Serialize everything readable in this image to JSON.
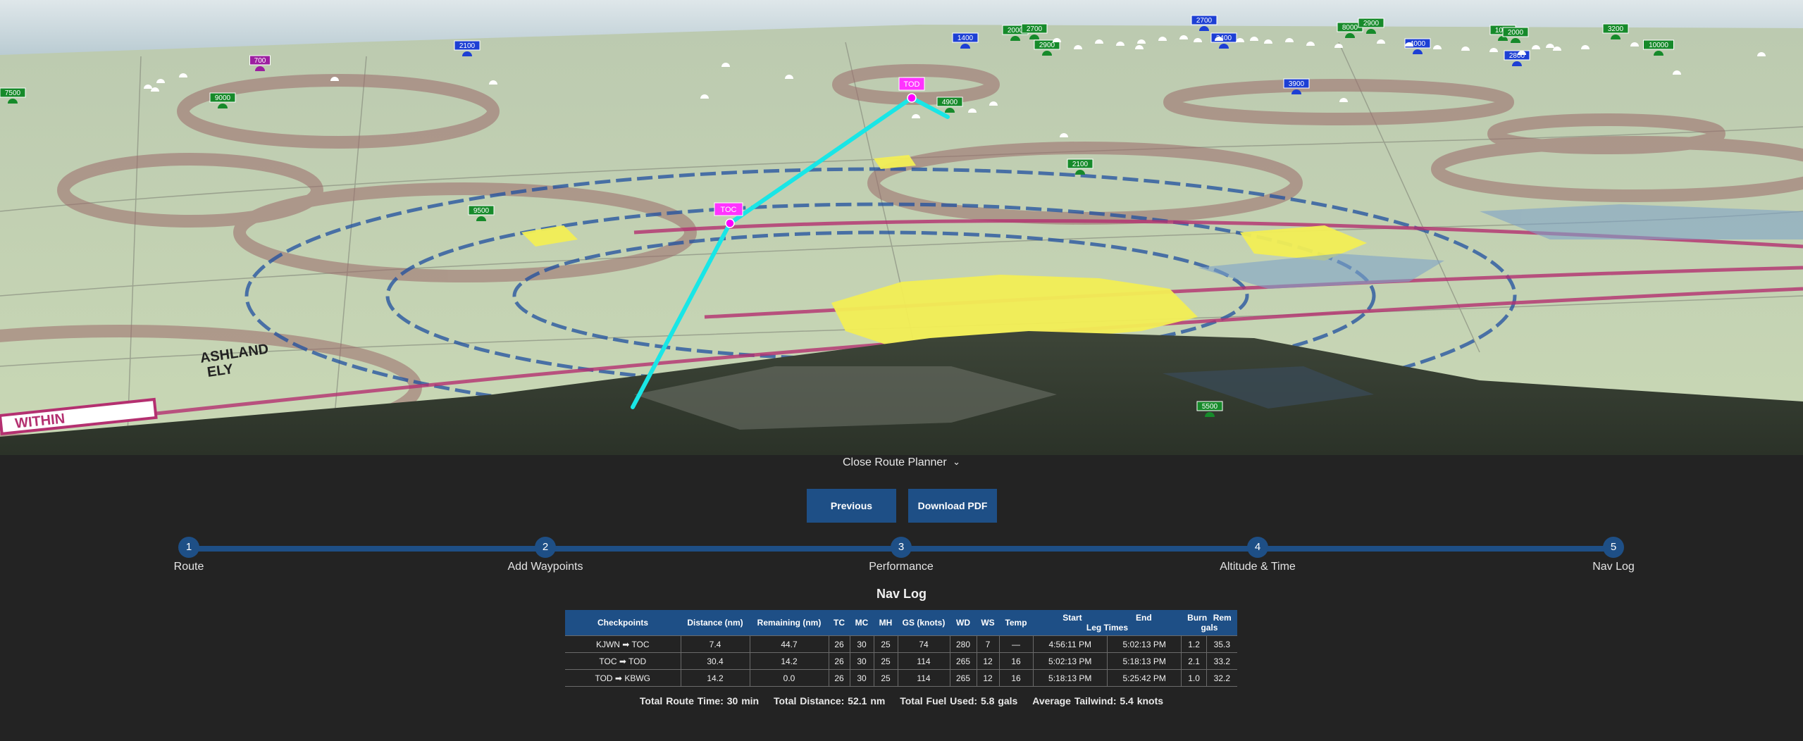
{
  "map": {
    "waypoint_labels": {
      "toc": "TOC",
      "tod": "TOD"
    },
    "altitude_markers": [
      "7500",
      "700",
      "2100",
      "9000",
      "1400",
      "2000",
      "2700",
      "2900",
      "2700",
      "2400",
      "8000",
      "2900",
      "4000",
      "2800",
      "3200",
      "10000",
      "3900",
      "4900",
      "2100",
      "9500",
      "5500",
      "1000",
      "2000"
    ],
    "chart_text": [
      "ASHLAND",
      "ELY",
      "WITHIN"
    ],
    "colors": {
      "route": "#19e6e6",
      "waypoint": "#ff00ff",
      "terrain": "#c8d6b0",
      "water": "#f4f04a"
    }
  },
  "panel": {
    "close_label": "Close Route Planner",
    "close_icon": "chevron-down-icon",
    "previous_label": "Previous",
    "download_label": "Download PDF",
    "steps": [
      {
        "num": "1",
        "label": "Route"
      },
      {
        "num": "2",
        "label": "Add Waypoints"
      },
      {
        "num": "3",
        "label": "Performance"
      },
      {
        "num": "4",
        "label": "Altitude & Time"
      },
      {
        "num": "5",
        "label": "Nav Log"
      }
    ],
    "current_step": 5
  },
  "navlog": {
    "title": "Nav Log",
    "headers": {
      "checkpoints": "Checkpoints",
      "distance": "Distance (nm)",
      "remaining": "Remaining (nm)",
      "tc": "TC",
      "mc": "MC",
      "mh": "MH",
      "gs": "GS (knots)",
      "wd": "WD",
      "ws": "WS",
      "temp": "Temp",
      "start": "Start",
      "end": "End",
      "leg_times": "Leg Times",
      "burn": "Burn",
      "rem": "Rem",
      "gals": "gals"
    },
    "rows": [
      {
        "checkpoints": "KJWN ➡ TOC",
        "distance": "7.4",
        "remaining": "44.7",
        "tc": "26",
        "mc": "30",
        "mh": "25",
        "gs": "74",
        "wd": "280",
        "ws": "7",
        "temp": "—",
        "start": "4:56:11 PM",
        "end": "5:02:13 PM",
        "burn": "1.2",
        "rem": "35.3"
      },
      {
        "checkpoints": "TOC ➡ TOD",
        "distance": "30.4",
        "remaining": "14.2",
        "tc": "26",
        "mc": "30",
        "mh": "25",
        "gs": "114",
        "wd": "265",
        "ws": "12",
        "temp": "16",
        "start": "5:02:13 PM",
        "end": "5:18:13 PM",
        "burn": "2.1",
        "rem": "33.2"
      },
      {
        "checkpoints": "TOD ➡ KBWG",
        "distance": "14.2",
        "remaining": "0.0",
        "tc": "26",
        "mc": "30",
        "mh": "25",
        "gs": "114",
        "wd": "265",
        "ws": "12",
        "temp": "16",
        "start": "5:18:13 PM",
        "end": "5:25:42 PM",
        "burn": "1.0",
        "rem": "32.2"
      }
    ],
    "totals": {
      "route_time": "Total Route Time: 30 min",
      "distance": "Total Distance: 52.1 nm",
      "fuel": "Total Fuel Used: 5.8 gals",
      "tailwind": "Average Tailwind: 5.4 knots"
    }
  }
}
